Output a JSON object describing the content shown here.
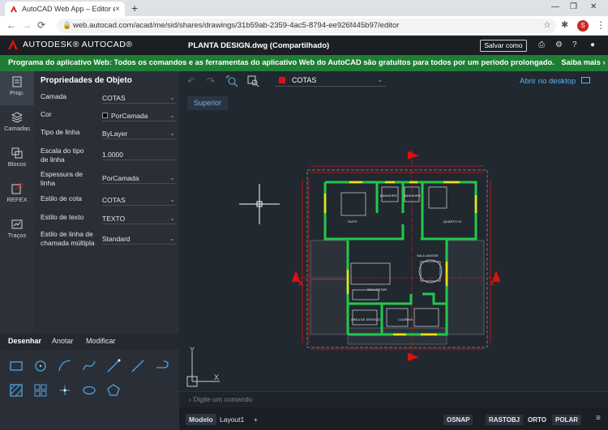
{
  "browser": {
    "tab_title": "AutoCAD Web App – Editor e vis",
    "tab_close": "×",
    "new_tab": "+",
    "url": "web.autocad.com/acad/me/sid/shares/drawings/31b59ab-2359-4ac5-8794-ee926f445b97/editor",
    "avatar_letter": "S"
  },
  "app": {
    "brand": "AUTODESK® AUTOCAD®",
    "doc_title": "PLANTA DESIGN.dwg (Compartilhado)",
    "save_as": "Salvar como"
  },
  "promo": {
    "text": "Programa do aplicativo Web: Todos os comandos e as ferramentas do aplicativo Web do AutoCAD são gratuitos para todos por um período prolongado.",
    "link": "Saiba mais ›"
  },
  "rail": [
    {
      "label": "Prop.",
      "icon": "properties-icon"
    },
    {
      "label": "Camadas",
      "icon": "layers-icon"
    },
    {
      "label": "Blocos",
      "icon": "blocks-icon"
    },
    {
      "label": "REFEX",
      "icon": "xref-icon"
    },
    {
      "label": "Traços",
      "icon": "traces-icon"
    }
  ],
  "properties": {
    "title": "Propriedades de Objeto",
    "rows": [
      {
        "label": "Camada",
        "value": "COTAS"
      },
      {
        "label": "Cor",
        "value": "PorCamada"
      },
      {
        "label": "Tipo de linha",
        "value": "ByLayer"
      },
      {
        "label": "Escala do tipo de linha",
        "value": "1.0000"
      },
      {
        "label": "Espessura de linha",
        "value": "PorCamada"
      },
      {
        "label": "Estilo de cota",
        "value": "COTAS"
      },
      {
        "label": "Estilo de texto",
        "value": "TEXTO"
      },
      {
        "label": "Estilo de linha de chamada múltipla",
        "value": "Standard"
      }
    ]
  },
  "draw_tabs": [
    "Desenhar",
    "Anotar",
    "Modificar"
  ],
  "canvas": {
    "layer": "COTAS",
    "open_desktop": "Abrir no desktop",
    "view": "Superior",
    "command_placeholder": "Digite um comando",
    "axis_x": "X",
    "axis_y": "Y"
  },
  "plan": {
    "room_labels": [
      "SUITE",
      "BANHEIRO",
      "BANHEIRO",
      "QUARTO 01",
      "SALA JANTAR",
      "SALA ESTAR",
      "ÁREA DE SERVIÇO",
      "COZINHA"
    ],
    "section_labels": [
      "B",
      "B",
      "A",
      "A"
    ]
  },
  "status": {
    "tabs": [
      "Modelo",
      "Layout1",
      "+"
    ],
    "buttons": [
      "OSNAP",
      "RASTOBJ",
      "ORTO",
      "POLAR"
    ]
  },
  "colors": {
    "promo_green": "#1e7e34",
    "accent_blue": "#5ab4f0",
    "wall_green": "#23c94a",
    "dim_red": "#e01010",
    "door_yellow": "#f2e011"
  }
}
